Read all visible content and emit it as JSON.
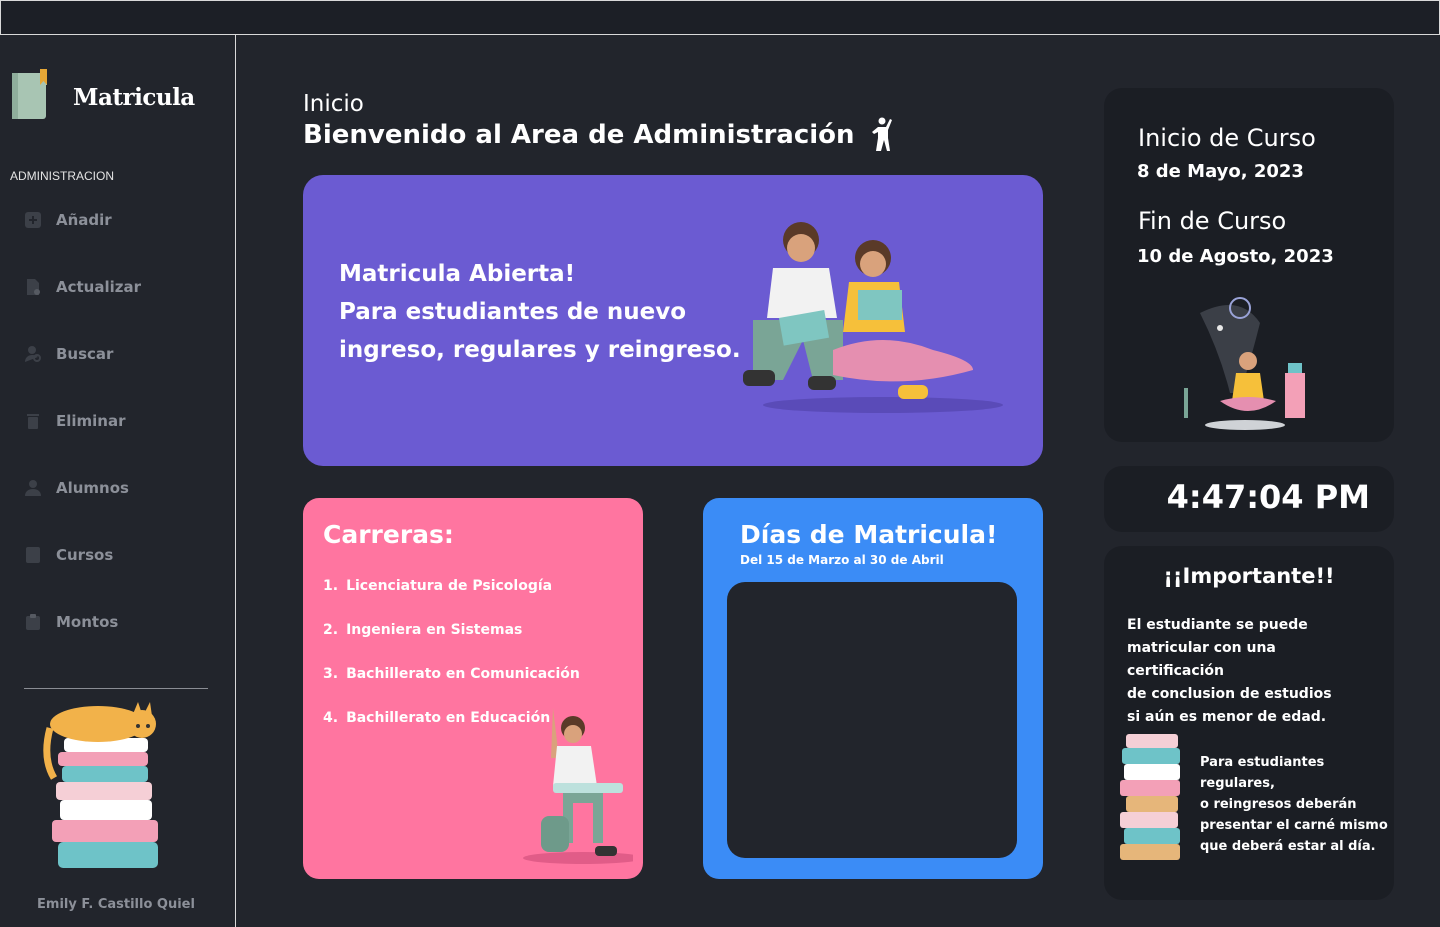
{
  "app": {
    "brand": "Matricula"
  },
  "sidebar": {
    "section": "ADMINISTRACION",
    "items": [
      {
        "label": "Añadir",
        "icon": "add-icon"
      },
      {
        "label": "Actualizar",
        "icon": "update-document-icon"
      },
      {
        "label": "Buscar",
        "icon": "search-user-icon"
      },
      {
        "label": "Eliminar",
        "icon": "trash-icon"
      },
      {
        "label": "Alumnos",
        "icon": "user-icon"
      },
      {
        "label": "Cursos",
        "icon": "book-icon"
      },
      {
        "label": "Montos",
        "icon": "clipboard-icon"
      }
    ],
    "author": "Emily F. Castillo Quiel"
  },
  "header": {
    "crumb": "Inicio",
    "title": "Bienvenido al Area de Administración"
  },
  "hero": {
    "line1": "Matricula Abierta!",
    "line2": "Para estudiantes de nuevo",
    "line3": "ingreso, regulares y reingreso."
  },
  "carreras": {
    "title": "Carreras:",
    "items": [
      {
        "num": "1.",
        "label": "Licenciatura de Psicología"
      },
      {
        "num": "2.",
        "label": "Ingeniera en Sistemas"
      },
      {
        "num": "3.",
        "label": "Bachillerato en Comunicación"
      },
      {
        "num": "4.",
        "label": "Bachillerato en Educación"
      }
    ]
  },
  "dias": {
    "title": "Días de Matricula!",
    "subtitle": "Del 15 de Marzo al 30 de Abril"
  },
  "course": {
    "start_label": "Inicio de Curso",
    "start_date": "8 de Mayo, 2023",
    "end_label": "Fin de Curso",
    "end_date": "10 de Agosto, 2023"
  },
  "clock": {
    "time": "4:47:04 PM"
  },
  "important": {
    "title": "¡¡Importante!!",
    "note1_lines": [
      "El estudiante se puede",
      "matricular con una certificación",
      "de conclusion de estudios",
      "si aún es menor de edad."
    ],
    "note2_lines": [
      "Para estudiantes regulares,",
      "o reingresos deberán",
      "presentar el carné mismo",
      "que deberá estar al día."
    ]
  },
  "colors": {
    "background": "#22252c",
    "card": "#1b1e24",
    "hero": "#6b5bd2",
    "carreras": "#ff75a0",
    "dias": "#3b8cf6",
    "muted_text": "#8c9099"
  }
}
